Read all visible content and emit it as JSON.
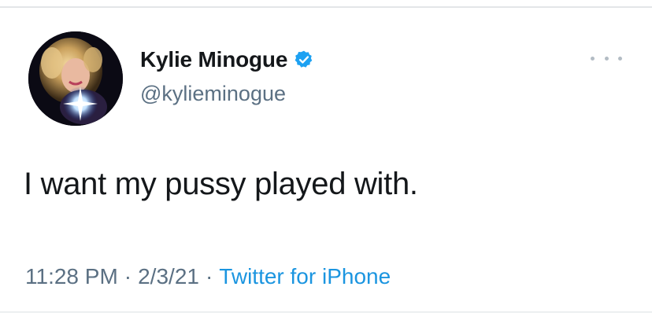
{
  "tweet": {
    "display_name": "Kylie Minogue",
    "handle": "@kylieminogue",
    "verified": true,
    "text": "I want my pussy played with.",
    "time": "11:28 PM",
    "date": "2/3/21",
    "separator": "·",
    "source": "Twitter for iPhone"
  },
  "icons": {
    "verified": "verified-badge-icon",
    "more": "more-options-icon"
  },
  "colors": {
    "name": "#14171a",
    "secondary": "#5b7083",
    "link": "#1b95e0",
    "verified": "#1da1f2"
  }
}
